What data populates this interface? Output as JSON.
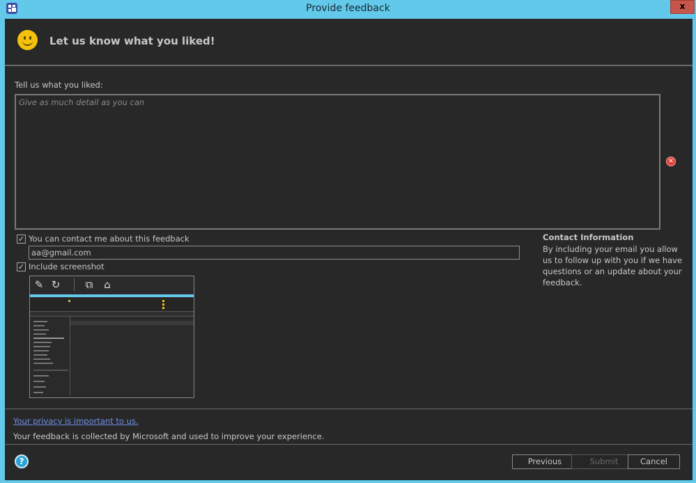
{
  "window": {
    "title": "Provide feedback",
    "close_label": "x",
    "app_icon": "feedback-app-icon"
  },
  "header": {
    "icon": "smiley-icon",
    "title": "Let us know what you liked!"
  },
  "feedback": {
    "label": "Tell us what you liked:",
    "placeholder": "Give as much detail as you can",
    "value": "",
    "error_icon": "error-icon"
  },
  "contact": {
    "checkbox_label": "You can contact me about this feedback",
    "checked": true,
    "email": "aa@gmail.com",
    "info_title": "Contact Information",
    "info_body": "By including your email you allow us to follow up with you if we have questions or an update about your feedback."
  },
  "screenshot": {
    "checkbox_label": "Include screenshot",
    "checked": true,
    "tools": [
      "annotate-icon",
      "refresh-icon",
      "copy-icon",
      "screenshot-crop-icon"
    ]
  },
  "privacy": {
    "link": "Your privacy is important to us.",
    "text": "Your feedback is collected by Microsoft and used to improve your experience."
  },
  "footer": {
    "help_icon": "?",
    "buttons": {
      "previous": "Previous",
      "submit": "Submit",
      "cancel": "Cancel"
    }
  },
  "colors": {
    "window_chrome": "#62c9ea",
    "dialog_bg": "#282828",
    "close_button": "#c6564b",
    "link": "#6e8fe6",
    "smiley": "#f4c20d"
  }
}
